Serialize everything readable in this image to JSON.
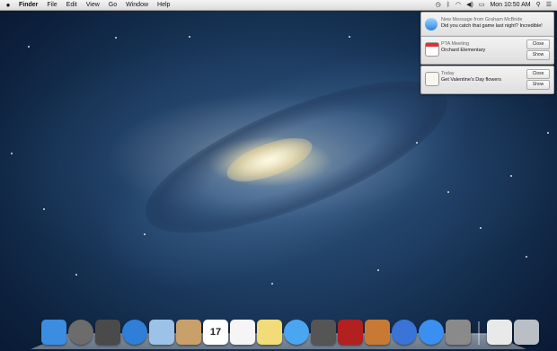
{
  "menubar": {
    "apple": "",
    "items": [
      "Finder",
      "File",
      "Edit",
      "View",
      "Go",
      "Window",
      "Help"
    ],
    "clock": "Mon 10:50 AM"
  },
  "notifications": [
    {
      "app": "Messages",
      "title": "New Message from Graham McBride",
      "body": "Did you catch that game last night? Incredible!",
      "buttons": []
    },
    {
      "app": "Calendar",
      "title": "PTA Meeting",
      "body": "Orchard Elementary",
      "buttons": [
        "Close",
        "Show"
      ]
    },
    {
      "app": "Reminders",
      "title": "Today",
      "body": "Get Valentine's Day flowers",
      "buttons": [
        "Close",
        "Show"
      ]
    }
  ],
  "dock": {
    "apps": [
      {
        "name": "finder-icon",
        "color": "#3a8de0"
      },
      {
        "name": "launchpad-icon",
        "color": "#6c6c6c"
      },
      {
        "name": "mission-control-icon",
        "color": "#4a4a4a"
      },
      {
        "name": "safari-icon",
        "color": "#2f7ed8"
      },
      {
        "name": "mail-icon",
        "color": "#9cc2e8"
      },
      {
        "name": "contacts-icon",
        "color": "#c9a06a"
      },
      {
        "name": "calendar-icon",
        "color": "#ffffff",
        "label": "17"
      },
      {
        "name": "reminders-icon",
        "color": "#f5f5f5"
      },
      {
        "name": "notes-icon",
        "color": "#f2dc78"
      },
      {
        "name": "messages-icon",
        "color": "#4aa6f0"
      },
      {
        "name": "facetime-icon",
        "color": "#555555"
      },
      {
        "name": "photo-booth-icon",
        "color": "#b22020"
      },
      {
        "name": "iphoto-icon",
        "color": "#c87a34"
      },
      {
        "name": "itunes-icon",
        "color": "#3a74d6"
      },
      {
        "name": "app-store-icon",
        "color": "#3b8ff0"
      },
      {
        "name": "system-preferences-icon",
        "color": "#8a8a8a"
      }
    ],
    "right": [
      {
        "name": "documents-stack-icon",
        "color": "#e9e9e9"
      },
      {
        "name": "trash-icon",
        "color": "#b9bfc5"
      }
    ]
  }
}
